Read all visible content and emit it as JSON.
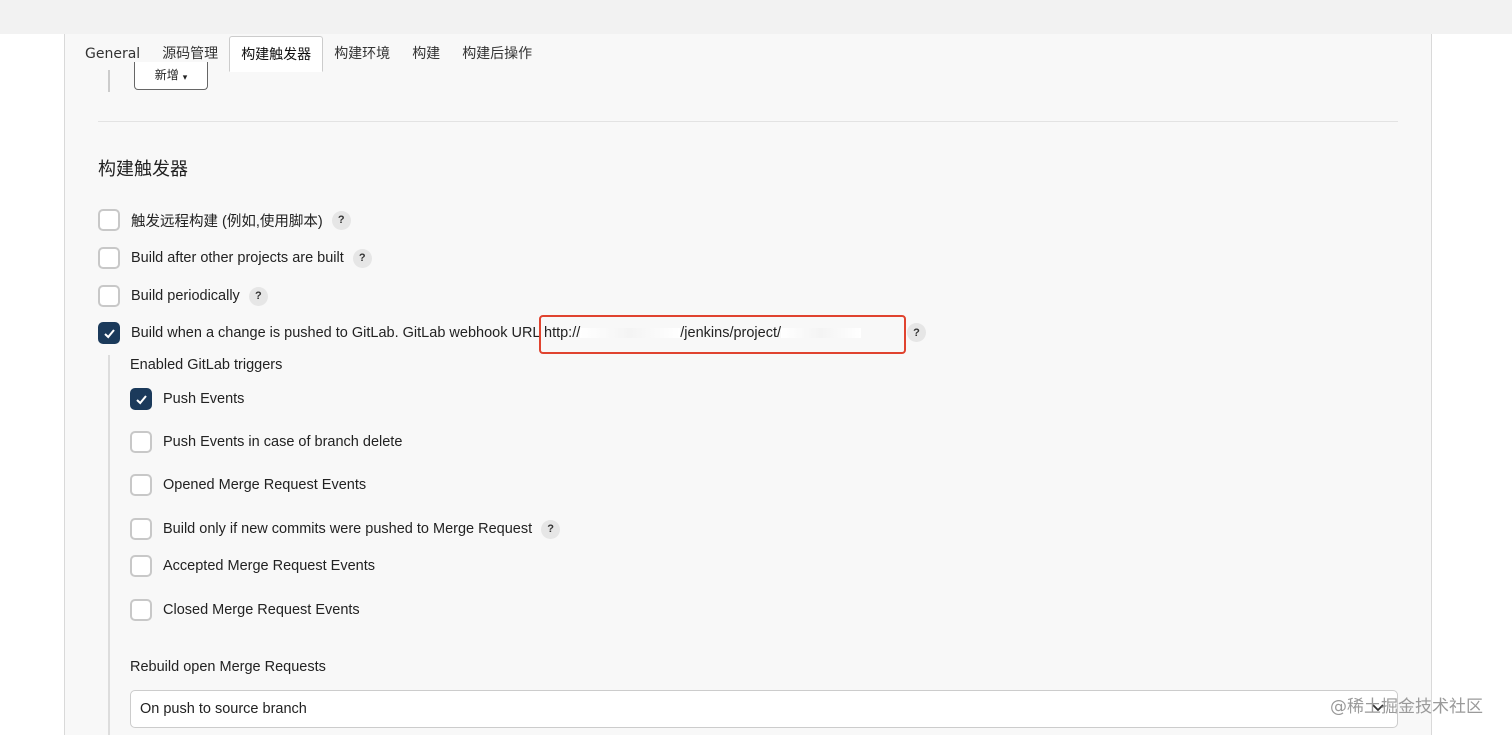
{
  "tabs": [
    {
      "label": "General"
    },
    {
      "label": "源码管理"
    },
    {
      "label": "构建触发器"
    },
    {
      "label": "构建环境"
    },
    {
      "label": "构建"
    },
    {
      "label": "构建后操作"
    }
  ],
  "add_button": {
    "label": "新增",
    "caret": "▾"
  },
  "section": {
    "title": "构建触发器"
  },
  "triggers": [
    {
      "label": "触发远程构建 (例如,使用脚本)",
      "checked": false
    },
    {
      "label": "Build after other projects are built",
      "checked": false
    },
    {
      "label": "Build periodically",
      "checked": false
    },
    {
      "label": "Build when a change is pushed to GitLab. GitLab webhook URL",
      "checked": true
    }
  ],
  "webhook": {
    "prefix": "http://",
    "middle": "/jenkins/project/"
  },
  "help_glyph": "?",
  "gitlab": {
    "enabled_title": "Enabled GitLab triggers",
    "events": [
      {
        "label": "Push Events",
        "checked": true
      },
      {
        "label": "Push Events in case of branch delete",
        "checked": false
      },
      {
        "label": "Opened Merge Request Events",
        "checked": false
      },
      {
        "label": "Build only if new commits were pushed to Merge Request",
        "checked": false
      },
      {
        "label": "Accepted Merge Request Events",
        "checked": false
      },
      {
        "label": "Closed Merge Request Events",
        "checked": false
      }
    ],
    "rebuild_title": "Rebuild open Merge Requests",
    "rebuild_value": "On push to source branch"
  },
  "watermark": "@稀土掘金技术社区",
  "colors": {
    "accent": "#1b3a5b",
    "highlight_box": "#e0432f"
  }
}
